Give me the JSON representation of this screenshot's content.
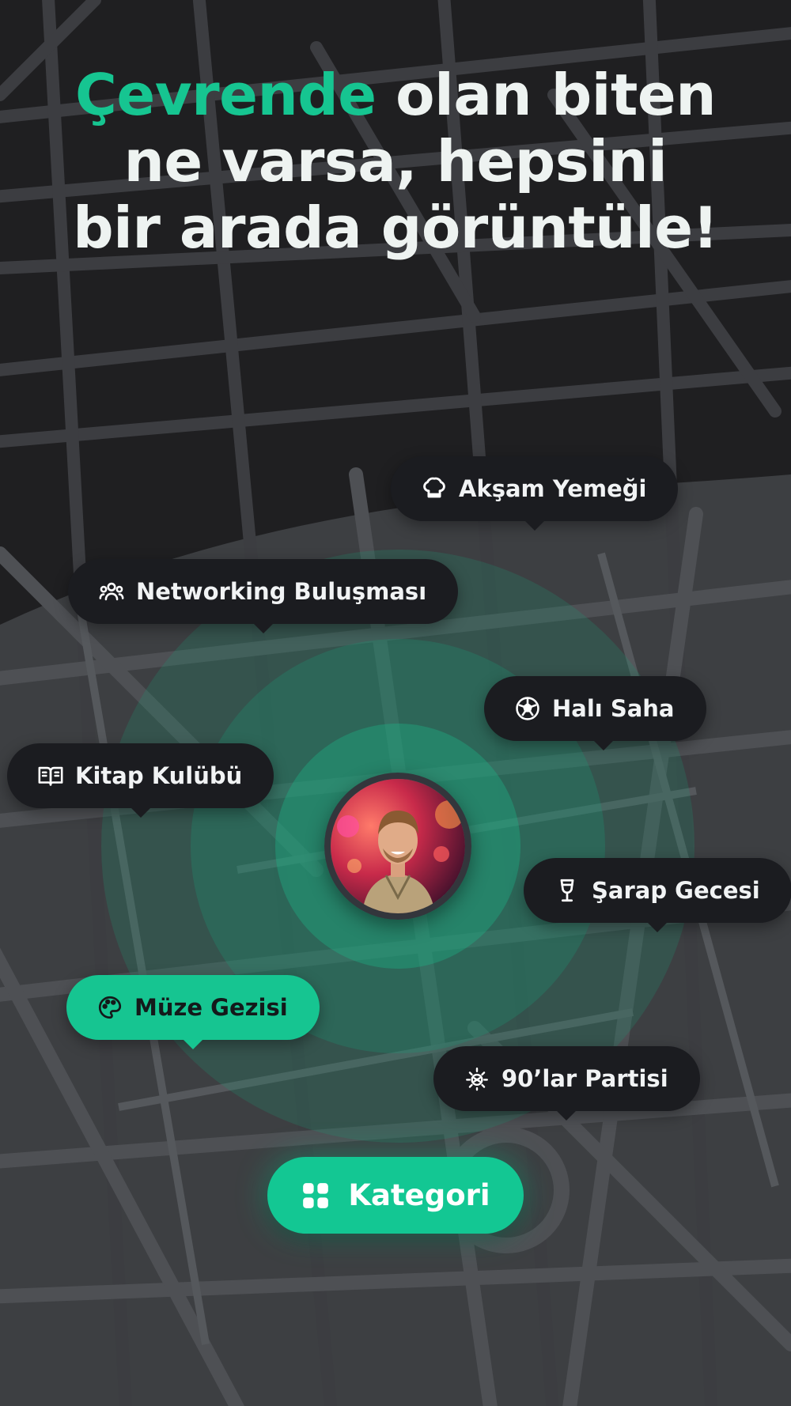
{
  "headline": {
    "accent_word": "Çevrende",
    "line1_rest": " olan biten",
    "line2": "ne varsa, hepsini",
    "line3": "bir arada görüntüle!"
  },
  "events": [
    {
      "label": "Akşam Yemeği",
      "icon": "chef-hat-icon",
      "active": false
    },
    {
      "label": "Networking Buluşması",
      "icon": "people-group-icon",
      "active": false
    },
    {
      "label": "Halı Saha",
      "icon": "soccer-ball-icon",
      "active": false
    },
    {
      "label": "Kitap Kulübü",
      "icon": "open-book-icon",
      "active": false
    },
    {
      "label": "Şarap Gecesi",
      "icon": "wine-glass-icon",
      "active": false
    },
    {
      "label": "Müze Gezisi",
      "icon": "palette-icon",
      "active": true
    },
    {
      "label": "90’lar Partisi",
      "icon": "disco-ball-icon",
      "active": false
    }
  ],
  "category_button": {
    "label": "Kategori",
    "icon": "grid-icon"
  },
  "user": {
    "avatar": "user-avatar"
  },
  "colors": {
    "accent": "#16c591",
    "pin_bg": "#1b1c20",
    "map_dark": "#1f1f21",
    "map_light": "#3e4043"
  }
}
